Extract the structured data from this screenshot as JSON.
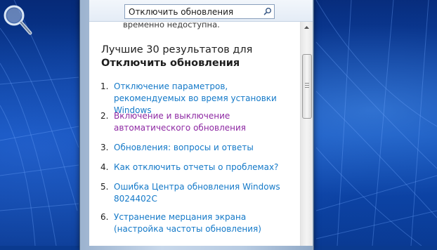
{
  "search": {
    "value": "Отключить обновления"
  },
  "content": {
    "truncated_text": "временно недоступна.",
    "results_heading": "Лучшие 30 результатов для",
    "results_query": "Отключить обновления",
    "results": [
      {
        "number": "1.",
        "title": "Отключение параметров, рекомендуемых во время установки Windows",
        "visited": false
      },
      {
        "number": "2.",
        "title": "Включение и выключение автоматического обновления",
        "visited": true
      },
      {
        "number": "3.",
        "title": "Обновления: вопросы и ответы",
        "visited": false
      },
      {
        "number": "4.",
        "title": "Как отключить отчеты о проблемах?",
        "visited": false
      },
      {
        "number": "5.",
        "title": "Ошибка Центра обновления Windows 8024402C",
        "visited": false
      },
      {
        "number": "6.",
        "title": "Устранение мерцания экрана (настройка частоты обновления)",
        "visited": false
      }
    ]
  },
  "colors": {
    "link": "#1479c8",
    "visited_link": "#8e29a3",
    "desktop": "#0a3a8f"
  },
  "icons": {
    "search": "magnifier-icon",
    "desktop_gadget": "magnifier-icon",
    "scroll_up": "arrow-up-icon",
    "scroll_down": "arrow-down-icon"
  }
}
